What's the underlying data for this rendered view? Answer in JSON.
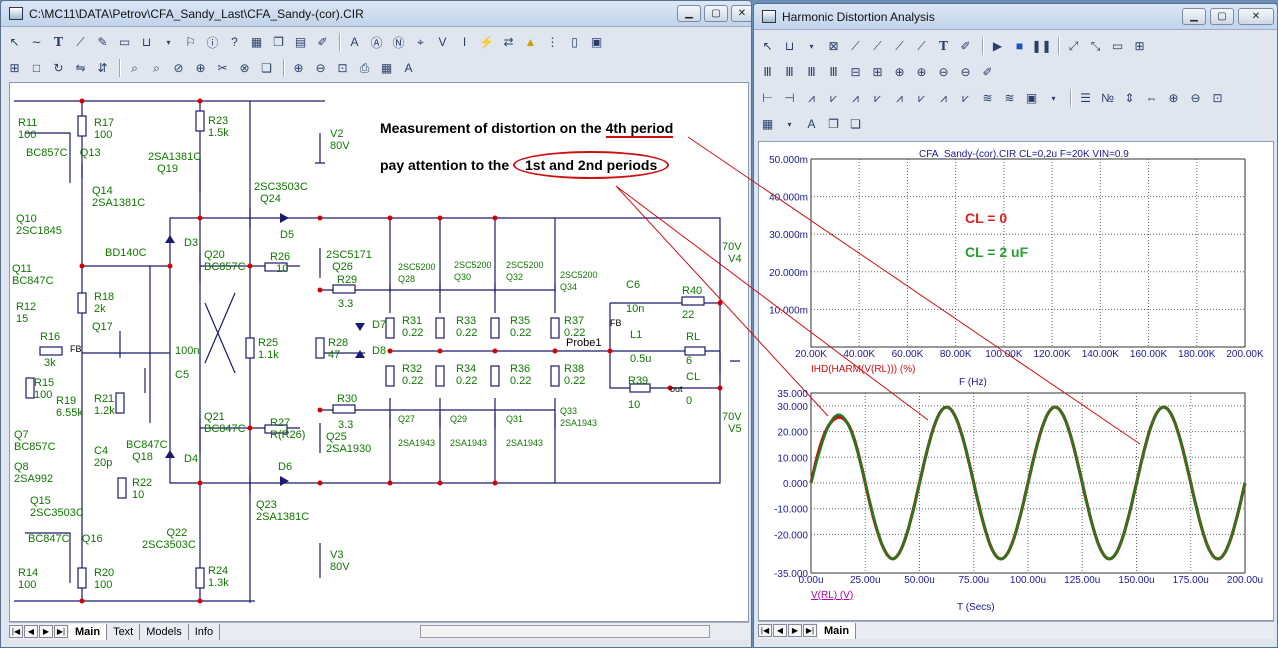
{
  "main_window": {
    "title": "C:\\MC11\\DATA\\Petrov\\CFA_Sandy_Last\\CFA_Sandy-(cor).CIR",
    "tabs": [
      "Main",
      "Text",
      "Models",
      "Info"
    ],
    "annotations": {
      "line1_pre": "Measurement of distortion on the ",
      "line1_hl": "4th period",
      "line2_pre": "pay attention to the ",
      "line2_hl": "1st and 2nd periods"
    },
    "labels": [
      [
        "R11",
        "100"
      ],
      [
        "R17",
        "100"
      ],
      [
        "R23",
        "1.5k"
      ],
      [
        "BC857C",
        "Q13"
      ],
      [
        "Q14",
        "2SA1381C"
      ],
      [
        "2SA1381C",
        "Q19"
      ],
      [
        "V2",
        "80V"
      ],
      [
        "2SC3503C",
        "Q24"
      ],
      [
        "D5"
      ],
      [
        "Q10",
        "2SC1845"
      ],
      [
        "BD140C"
      ],
      [
        "D3"
      ],
      [
        "Q20",
        "BC857C"
      ],
      [
        "R26",
        "10"
      ],
      [
        "2SC5171",
        "Q26"
      ],
      [
        "R29",
        "3.3"
      ],
      [
        "Q11",
        "BC847C"
      ],
      [
        "R12",
        "15"
      ],
      [
        "R18",
        "2k"
      ],
      [
        "Q17"
      ],
      [
        "R16",
        "3k"
      ],
      [
        "FB"
      ],
      [
        "R15",
        "100"
      ],
      [
        "R19",
        "6.55k"
      ],
      [
        "R21",
        "1.2k"
      ],
      [
        "100n",
        "C5"
      ],
      [
        "R25",
        "1.1k"
      ],
      [
        "R28",
        "47"
      ],
      [
        "D7"
      ],
      [
        "D8"
      ],
      [
        "R30",
        "3.3"
      ],
      [
        "Q7",
        "BC857C"
      ],
      [
        "C4",
        "20p"
      ],
      [
        "BC847C",
        "Q18"
      ],
      [
        "Q21",
        "BC847C"
      ],
      [
        "D4"
      ],
      [
        "R27",
        "R(R26)"
      ],
      [
        "Q25",
        "2SA1930"
      ],
      [
        "Q8",
        "2SA992"
      ],
      [
        "R22",
        "10"
      ],
      [
        "D6"
      ],
      [
        "Q15",
        "2SC3503C"
      ],
      [
        "Q23",
        "2SA1381C"
      ],
      [
        "Q16",
        "BC847C"
      ],
      [
        "Q22",
        "2SC3503C"
      ],
      [
        "V3",
        "80V"
      ],
      [
        "R14",
        "100"
      ],
      [
        "R20",
        "100"
      ],
      [
        "R24",
        "1.3k"
      ],
      [
        "2SC5200",
        "Q28"
      ],
      [
        "2SC5200",
        "Q30"
      ],
      [
        "2SC5200",
        "Q32"
      ],
      [
        "2SC5200",
        "Q34"
      ],
      [
        "R31",
        "0.22"
      ],
      [
        "R33",
        "0.22"
      ],
      [
        "R35",
        "0.22"
      ],
      [
        "R37",
        "0.22"
      ],
      [
        "R32",
        "0.22"
      ],
      [
        "R34",
        "0.22"
      ],
      [
        "R36",
        "0.22"
      ],
      [
        "R38",
        "0.22"
      ],
      [
        "Q27",
        "2SA1943"
      ],
      [
        "Q29",
        "2SA1943"
      ],
      [
        "Q31",
        "2SA1943"
      ],
      [
        "Q33",
        "2SA1943"
      ],
      [
        "C6",
        "10n"
      ],
      [
        "R40",
        "22"
      ],
      [
        "FB"
      ],
      [
        "L1",
        "0.5u"
      ],
      [
        "RL",
        "6"
      ],
      [
        "Probe1"
      ],
      [
        "R39",
        "10"
      ],
      [
        "CL",
        "0"
      ],
      [
        "out"
      ],
      [
        "70V",
        "V4"
      ],
      [
        "70V",
        "V5"
      ]
    ]
  },
  "harmonic_window": {
    "title": "Harmonic Distortion Analysis",
    "tabs": [
      "Main"
    ]
  },
  "chart_data": [
    {
      "type": "line",
      "title": "CFA_Sandy-(cor).CIR CL=0,2u F=20K VIN=0.9",
      "xlabel": "F (Hz)",
      "ylabel": "IHD(HARM(V(RL))) (%)",
      "xlim": [
        20000,
        200000
      ],
      "ylim": [
        0,
        50
      ],
      "x_ticks": [
        "20.00K",
        "40.00K",
        "60.00K",
        "80.00K",
        "100.00K",
        "120.00K",
        "140.00K",
        "160.00K",
        "180.00K",
        "200.00K"
      ],
      "y_ticks": [
        "50.000m",
        "40.000m",
        "30.000m",
        "20.000m",
        "10.000m"
      ],
      "legend": [
        {
          "name": "CL = 0",
          "color": "#e02020"
        },
        {
          "name": "CL = 2 uF",
          "color": "#23a030"
        }
      ]
    },
    {
      "type": "line",
      "xlabel": "T (Secs)",
      "ylabel": "V(RL) (V)",
      "xlim": [
        0,
        200
      ],
      "ylim": [
        -35,
        35
      ],
      "x_ticks": [
        "0.00u",
        "25.00u",
        "50.00u",
        "75.00u",
        "100.00u",
        "125.00u",
        "150.00u",
        "175.00u",
        "200.00u"
      ],
      "y_ticks": [
        "35.000",
        "30.000",
        "20.000",
        "10.000",
        "0.000",
        "-10.000",
        "-20.000",
        "-35.000"
      ],
      "series": [
        {
          "name": "CL = 0",
          "color": "#d01010",
          "amplitude": 29.5,
          "frequency_hz": 20000
        },
        {
          "name": "CL = 2 uF",
          "color": "#1e7d1e",
          "amplitude": 29.5,
          "frequency_hz": 20000
        }
      ]
    }
  ]
}
